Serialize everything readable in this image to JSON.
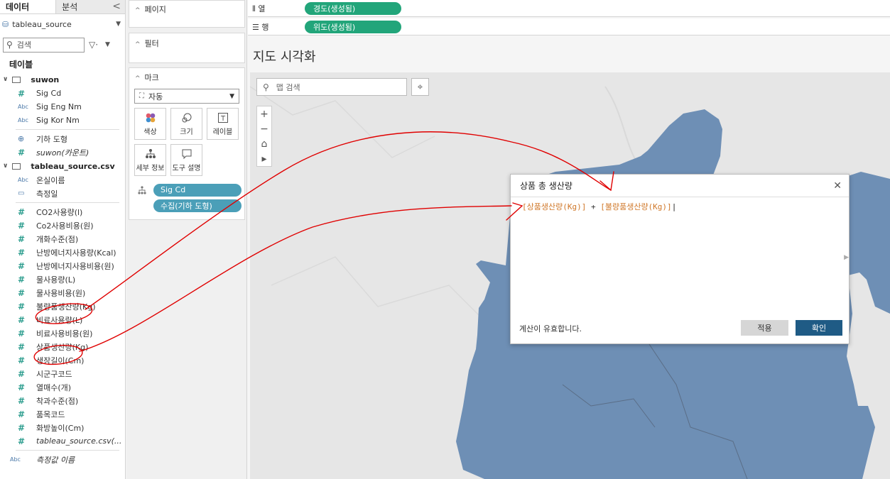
{
  "left_pane": {
    "tabs": [
      "데이터",
      "분석"
    ],
    "collapse_glyph": "<",
    "datasource": "tableau_source",
    "search_placeholder": "검색",
    "section_title": "테이블",
    "tables": [
      {
        "name": "suwon",
        "fields": [
          {
            "type": "hash",
            "name": "Sig Cd"
          },
          {
            "type": "abc",
            "name": "Sig Eng Nm"
          },
          {
            "type": "abc",
            "name": "Sig Kor Nm"
          }
        ],
        "extra": [
          {
            "type": "glob",
            "name": "기하 도형",
            "italic": false
          },
          {
            "type": "hash",
            "name": "suwon(카운트)",
            "italic": true
          }
        ]
      },
      {
        "name": "tableau_source.csv",
        "fields": [
          {
            "type": "abc",
            "name": "온실이름"
          },
          {
            "type": "cal",
            "name": "측정일"
          }
        ],
        "extra": [
          {
            "type": "hash",
            "name": "CO2사용량(l)",
            "italic": false
          },
          {
            "type": "hash",
            "name": "Co2사용비용(원)",
            "italic": false
          },
          {
            "type": "hash",
            "name": "개화수준(점)",
            "italic": false
          },
          {
            "type": "hash",
            "name": "난방에너지사용량(Kcal)",
            "italic": false
          },
          {
            "type": "hash",
            "name": "난방에너지사용비용(원)",
            "italic": false
          },
          {
            "type": "hash",
            "name": "물사용량(L)",
            "italic": false
          },
          {
            "type": "hash",
            "name": "물사용비용(원)",
            "italic": false
          },
          {
            "type": "hash",
            "name": "불량품생산량(Kg)",
            "italic": false
          },
          {
            "type": "hash",
            "name": "비료사용량(L)",
            "italic": false
          },
          {
            "type": "hash",
            "name": "비료사용비용(원)",
            "italic": false
          },
          {
            "type": "hash",
            "name": "상품생산량(Kg)",
            "italic": false
          },
          {
            "type": "hash",
            "name": "생장길이(Cm)",
            "italic": false
          },
          {
            "type": "hash",
            "name": "시군구코드",
            "italic": false
          },
          {
            "type": "hash",
            "name": "열매수(개)",
            "italic": false
          },
          {
            "type": "hash",
            "name": "착과수준(점)",
            "italic": false
          },
          {
            "type": "hash",
            "name": "품목코드",
            "italic": false
          },
          {
            "type": "hash",
            "name": "화방높이(Cm)",
            "italic": false
          },
          {
            "type": "hash",
            "name": "tableau_source.csv(...",
            "italic": true
          }
        ]
      }
    ],
    "measure_names": "측정값 이름"
  },
  "cards": {
    "pages": "페이지",
    "filters": "필터",
    "marks": "마크",
    "mark_type": "자동",
    "mark_buttons": [
      {
        "label": "색상",
        "icon": "color-icon"
      },
      {
        "label": "크기",
        "icon": "size-icon"
      },
      {
        "label": "레이블",
        "icon": "label-icon"
      },
      {
        "label": "세부 정보",
        "icon": "detail-icon"
      },
      {
        "label": "도구 설명",
        "icon": "tooltip-icon"
      }
    ],
    "pills": [
      "Sig Cd",
      "수집(기하 도형)"
    ]
  },
  "shelves": {
    "columns_label": "열",
    "columns_pill": "경도(생성됨)",
    "rows_label": "행",
    "rows_pill": "위도(생성됨)"
  },
  "view": {
    "title": "지도 시각화",
    "map_search_placeholder": "맵 검색",
    "zoom_in": "+",
    "zoom_out": "−",
    "home": "⌂",
    "pan": "▸"
  },
  "dialog": {
    "title": "상품 총 생산량",
    "formula_field1": "[상품생산량(Kg)]",
    "formula_op": "+",
    "formula_field2": "[불량품생산량(Kg)]",
    "status": "계산이 유효합니다.",
    "apply": "적용",
    "ok": "확인"
  },
  "colors": {
    "map_region": "#6e8fb5",
    "map_bg": "#e6e6e6",
    "green_pill": "#22a57a",
    "blue_pill": "#4b9fb8",
    "ok_button": "#1f5b85",
    "formula_field": "#d0782a",
    "annotation": "#e00000"
  }
}
